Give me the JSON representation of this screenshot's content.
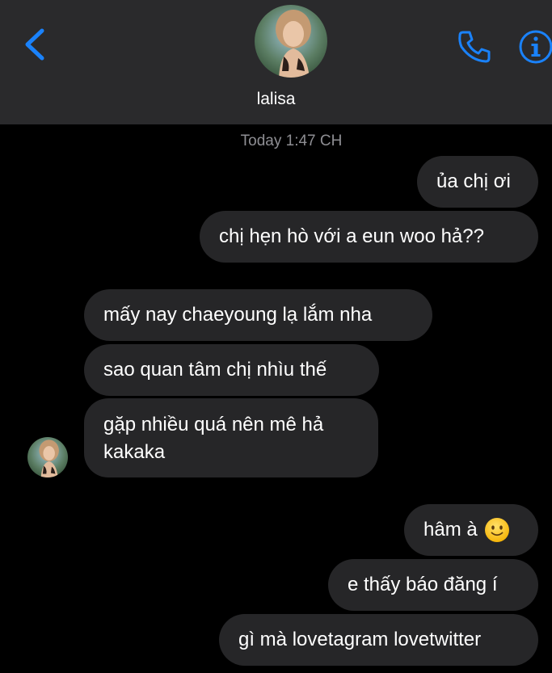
{
  "header": {
    "contact_name": "lalisa",
    "accent_color": "#1a82fb",
    "back_icon": "chevron-left-icon",
    "phone_icon": "phone-icon",
    "info_icon": "info-icon"
  },
  "thread": {
    "timestamp": "Today 1:47 CH",
    "messages": [
      {
        "sender": "me",
        "text": "ủa chị ơi"
      },
      {
        "sender": "me",
        "text": "chị hẹn hò với a eun woo hả??"
      },
      {
        "sender": "them",
        "text": "mấy nay chaeyoung lạ lắm nha"
      },
      {
        "sender": "them",
        "text": "sao quan tâm chị nhìu thế"
      },
      {
        "sender": "them",
        "text": "gặp nhiều quá nên mê hả kakaka"
      },
      {
        "sender": "me",
        "text": "hâm à",
        "emoji": "slightly-smiling-face-icon"
      },
      {
        "sender": "me",
        "text": "e thấy báo đăng í"
      },
      {
        "sender": "me",
        "text": "gì mà lovetagram lovetwitter"
      }
    ]
  },
  "colors": {
    "background": "#000000",
    "header_bg": "#2a2a2c",
    "bubble_bg": "#262628",
    "timestamp": "#8e8e93"
  }
}
